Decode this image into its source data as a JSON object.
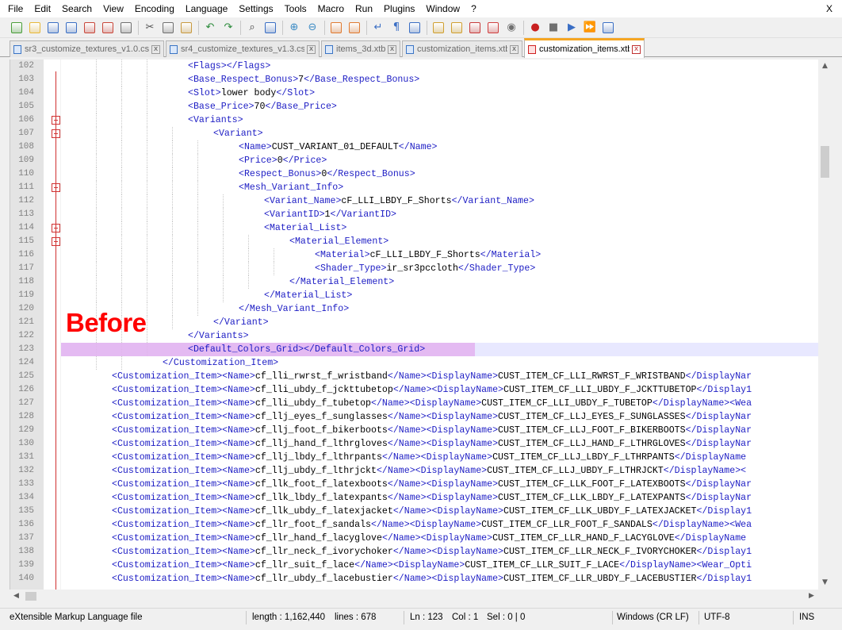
{
  "menu": [
    "File",
    "Edit",
    "Search",
    "View",
    "Encoding",
    "Language",
    "Settings",
    "Tools",
    "Macro",
    "Run",
    "Plugins",
    "Window",
    "?"
  ],
  "window_close": "X",
  "toolbar": [
    {
      "icon": "new-file-icon",
      "color": "#4a9e3a",
      "group_end": false
    },
    {
      "icon": "open-file-icon",
      "color": "#e8b838",
      "group_end": false
    },
    {
      "icon": "save-icon",
      "color": "#3a6ec4",
      "group_end": false
    },
    {
      "icon": "save-all-icon",
      "color": "#3a6ec4",
      "group_end": false
    },
    {
      "icon": "close-icon",
      "color": "#c8463a",
      "group_end": false
    },
    {
      "icon": "close-all-icon",
      "color": "#c8463a",
      "group_end": false
    },
    {
      "icon": "print-icon",
      "color": "#707070",
      "group_end": true
    },
    {
      "icon": "cut-icon",
      "color": "#505050",
      "group_end": false
    },
    {
      "icon": "copy-icon",
      "color": "#707070",
      "group_end": false
    },
    {
      "icon": "paste-icon",
      "color": "#c89a40",
      "group_end": true
    },
    {
      "icon": "undo-icon",
      "color": "#2a8a3a",
      "group_end": false
    },
    {
      "icon": "redo-icon",
      "color": "#2a8a3a",
      "group_end": true
    },
    {
      "icon": "find-icon",
      "color": "#404040",
      "group_end": false
    },
    {
      "icon": "replace-icon",
      "color": "#3a6ec4",
      "group_end": true
    },
    {
      "icon": "zoom-in-icon",
      "color": "#3a8ac4",
      "group_end": false
    },
    {
      "icon": "zoom-out-icon",
      "color": "#3a8ac4",
      "group_end": true
    },
    {
      "icon": "sync-vertical-icon",
      "color": "#e07a30",
      "group_end": false
    },
    {
      "icon": "sync-horizontal-icon",
      "color": "#e07a30",
      "group_end": true
    },
    {
      "icon": "word-wrap-icon",
      "color": "#3a6ec4",
      "group_end": false
    },
    {
      "icon": "show-all-characters-icon",
      "color": "#3a6ec4",
      "group_end": false
    },
    {
      "icon": "indent-guide-icon",
      "color": "#3a6ec4",
      "group_end": true
    },
    {
      "icon": "user-language-icon",
      "color": "#d0a030",
      "group_end": false
    },
    {
      "icon": "document-map-icon",
      "color": "#d0a030",
      "group_end": false
    },
    {
      "icon": "function-list-icon",
      "color": "#c83a3a",
      "group_end": false
    },
    {
      "icon": "folder-workspace-icon",
      "color": "#d04040",
      "group_end": false
    },
    {
      "icon": "monitoring-icon",
      "color": "#707070",
      "group_end": true
    },
    {
      "icon": "record-macro-icon",
      "color": "#c82020",
      "group_end": false
    },
    {
      "icon": "stop-recording-icon",
      "color": "#707070",
      "group_end": false
    },
    {
      "icon": "playback-macro-icon",
      "color": "#3a6ec4",
      "group_end": false
    },
    {
      "icon": "run-macro-multiple-icon",
      "color": "#3a6ec4",
      "group_end": false
    },
    {
      "icon": "save-macro-icon",
      "color": "#3a6ec4",
      "group_end": false
    }
  ],
  "tabs": [
    {
      "label": "sr3_customize_textures_v1.0.csv",
      "active": false,
      "close": "x"
    },
    {
      "label": "sr4_customize_textures_v1.3.csv",
      "active": false,
      "close": "x"
    },
    {
      "label": "items_3d.xtbl",
      "active": false,
      "close": "x"
    },
    {
      "label": "customization_items.xtbl",
      "active": false,
      "close": "x"
    },
    {
      "label": "customization_items.xtbl",
      "active": true,
      "close": "x"
    }
  ],
  "annotation": "Before",
  "lines": [
    {
      "n": "102",
      "indent": 4,
      "parts": [
        [
          "t",
          "<Flags></Flags>"
        ]
      ]
    },
    {
      "n": "103",
      "indent": 4,
      "parts": [
        [
          "t",
          "<Base_Respect_Bonus>"
        ],
        [
          "v",
          "7"
        ],
        [
          "t",
          "</Base_Respect_Bonus>"
        ]
      ]
    },
    {
      "n": "104",
      "indent": 4,
      "parts": [
        [
          "t",
          "<Slot>"
        ],
        [
          "v",
          "lower body"
        ],
        [
          "t",
          "</Slot>"
        ]
      ]
    },
    {
      "n": "105",
      "indent": 4,
      "parts": [
        [
          "t",
          "<Base_Price>"
        ],
        [
          "v",
          "70"
        ],
        [
          "t",
          "</Base_Price>"
        ]
      ]
    },
    {
      "n": "106",
      "indent": 4,
      "fold": true,
      "parts": [
        [
          "t",
          "<Variants>"
        ]
      ]
    },
    {
      "n": "107",
      "indent": 5,
      "fold": true,
      "parts": [
        [
          "t",
          "<Variant>"
        ]
      ]
    },
    {
      "n": "108",
      "indent": 6,
      "parts": [
        [
          "t",
          "<Name>"
        ],
        [
          "v",
          "CUST_VARIANT_01_DEFAULT"
        ],
        [
          "t",
          "</Name>"
        ]
      ]
    },
    {
      "n": "109",
      "indent": 6,
      "parts": [
        [
          "t",
          "<Price>"
        ],
        [
          "v",
          "0"
        ],
        [
          "t",
          "</Price>"
        ]
      ]
    },
    {
      "n": "110",
      "indent": 6,
      "parts": [
        [
          "t",
          "<Respect_Bonus>"
        ],
        [
          "v",
          "0"
        ],
        [
          "t",
          "</Respect_Bonus>"
        ]
      ]
    },
    {
      "n": "111",
      "indent": 6,
      "fold": true,
      "parts": [
        [
          "t",
          "<Mesh_Variant_Info>"
        ]
      ]
    },
    {
      "n": "112",
      "indent": 7,
      "parts": [
        [
          "t",
          "<Variant_Name>"
        ],
        [
          "v",
          "cF_LLI_LBDY_F_Shorts"
        ],
        [
          "t",
          "</Variant_Name>"
        ]
      ]
    },
    {
      "n": "113",
      "indent": 7,
      "parts": [
        [
          "t",
          "<VariantID>"
        ],
        [
          "v",
          "1"
        ],
        [
          "t",
          "</VariantID>"
        ]
      ]
    },
    {
      "n": "114",
      "indent": 7,
      "fold": true,
      "parts": [
        [
          "t",
          "<Material_List>"
        ]
      ]
    },
    {
      "n": "115",
      "indent": 8,
      "fold": true,
      "parts": [
        [
          "t",
          "<Material_Element>"
        ]
      ]
    },
    {
      "n": "116",
      "indent": 9,
      "parts": [
        [
          "t",
          "<Material>"
        ],
        [
          "v",
          "cF_LLI_LBDY_F_Shorts"
        ],
        [
          "t",
          "</Material>"
        ]
      ]
    },
    {
      "n": "117",
      "indent": 9,
      "parts": [
        [
          "t",
          "<Shader_Type>"
        ],
        [
          "v",
          "ir_sr3pccloth"
        ],
        [
          "t",
          "</Shader_Type>"
        ]
      ]
    },
    {
      "n": "118",
      "indent": 8,
      "parts": [
        [
          "t",
          "</Material_Element>"
        ]
      ]
    },
    {
      "n": "119",
      "indent": 7,
      "parts": [
        [
          "t",
          "</Material_List>"
        ]
      ]
    },
    {
      "n": "120",
      "indent": 6,
      "parts": [
        [
          "t",
          "</Mesh_Variant_Info>"
        ]
      ]
    },
    {
      "n": "121",
      "indent": 5,
      "parts": [
        [
          "t",
          "</Variant>"
        ]
      ]
    },
    {
      "n": "122",
      "indent": 4,
      "parts": [
        [
          "t",
          "</Variants>"
        ]
      ]
    },
    {
      "n": "123",
      "indent": 4,
      "current": true,
      "parts": [
        [
          "t",
          "<Default_Colors_Grid></Default_Colors_Grid>"
        ]
      ]
    },
    {
      "n": "124",
      "indent": 3,
      "parts": [
        [
          "t",
          "</Customization_Item>"
        ]
      ]
    },
    {
      "n": "125",
      "indent": 1,
      "parts": [
        [
          "t",
          "<Customization_Item><Name>"
        ],
        [
          "v",
          "cf_lli_rwrst_f_wristband"
        ],
        [
          "t",
          "</Name><DisplayName>"
        ],
        [
          "v",
          "CUST_ITEM_CF_LLI_RWRST_F_WRISTBAND"
        ],
        [
          "t",
          "</DisplayNar"
        ]
      ]
    },
    {
      "n": "126",
      "indent": 1,
      "parts": [
        [
          "t",
          "<Customization_Item><Name>"
        ],
        [
          "v",
          "cf_lli_ubdy_f_jckttubetop"
        ],
        [
          "t",
          "</Name><DisplayName>"
        ],
        [
          "v",
          "CUST_ITEM_CF_LLI_UBDY_F_JCKTTUBETOP"
        ],
        [
          "t",
          "</Display1"
        ]
      ]
    },
    {
      "n": "127",
      "indent": 1,
      "parts": [
        [
          "t",
          "<Customization_Item><Name>"
        ],
        [
          "v",
          "cf_lli_ubdy_f_tubetop"
        ],
        [
          "t",
          "</Name><DisplayName>"
        ],
        [
          "v",
          "CUST_ITEM_CF_LLI_UBDY_F_TUBETOP"
        ],
        [
          "t",
          "</DisplayName><Wea"
        ]
      ]
    },
    {
      "n": "128",
      "indent": 1,
      "parts": [
        [
          "t",
          "<Customization_Item><Name>"
        ],
        [
          "v",
          "cf_llj_eyes_f_sunglasses"
        ],
        [
          "t",
          "</Name><DisplayName>"
        ],
        [
          "v",
          "CUST_ITEM_CF_LLJ_EYES_F_SUNGLASSES"
        ],
        [
          "t",
          "</DisplayNar"
        ]
      ]
    },
    {
      "n": "129",
      "indent": 1,
      "parts": [
        [
          "t",
          "<Customization_Item><Name>"
        ],
        [
          "v",
          "cf_llj_foot_f_bikerboots"
        ],
        [
          "t",
          "</Name><DisplayName>"
        ],
        [
          "v",
          "CUST_ITEM_CF_LLJ_FOOT_F_BIKERBOOTS"
        ],
        [
          "t",
          "</DisplayNar"
        ]
      ]
    },
    {
      "n": "130",
      "indent": 1,
      "parts": [
        [
          "t",
          "<Customization_Item><Name>"
        ],
        [
          "v",
          "cf_llj_hand_f_lthrgloves"
        ],
        [
          "t",
          "</Name><DisplayName>"
        ],
        [
          "v",
          "CUST_ITEM_CF_LLJ_HAND_F_LTHRGLOVES"
        ],
        [
          "t",
          "</DisplayNar"
        ]
      ]
    },
    {
      "n": "131",
      "indent": 1,
      "parts": [
        [
          "t",
          "<Customization_Item><Name>"
        ],
        [
          "v",
          "cf_llj_lbdy_f_lthrpants"
        ],
        [
          "t",
          "</Name><DisplayName>"
        ],
        [
          "v",
          "CUST_ITEM_CF_LLJ_LBDY_F_LTHRPANTS"
        ],
        [
          "t",
          "</DisplayName"
        ]
      ]
    },
    {
      "n": "132",
      "indent": 1,
      "parts": [
        [
          "t",
          "<Customization_Item><Name>"
        ],
        [
          "v",
          "cf_llj_ubdy_f_lthrjckt"
        ],
        [
          "t",
          "</Name><DisplayName>"
        ],
        [
          "v",
          "CUST_ITEM_CF_LLJ_UBDY_F_LTHRJCKT"
        ],
        [
          "t",
          "</DisplayName><"
        ]
      ]
    },
    {
      "n": "133",
      "indent": 1,
      "parts": [
        [
          "t",
          "<Customization_Item><Name>"
        ],
        [
          "v",
          "cf_llk_foot_f_latexboots"
        ],
        [
          "t",
          "</Name><DisplayName>"
        ],
        [
          "v",
          "CUST_ITEM_CF_LLK_FOOT_F_LATEXBOOTS"
        ],
        [
          "t",
          "</DisplayNar"
        ]
      ]
    },
    {
      "n": "134",
      "indent": 1,
      "parts": [
        [
          "t",
          "<Customization_Item><Name>"
        ],
        [
          "v",
          "cf_llk_lbdy_f_latexpants"
        ],
        [
          "t",
          "</Name><DisplayName>"
        ],
        [
          "v",
          "CUST_ITEM_CF_LLK_LBDY_F_LATEXPANTS"
        ],
        [
          "t",
          "</DisplayNar"
        ]
      ]
    },
    {
      "n": "135",
      "indent": 1,
      "parts": [
        [
          "t",
          "<Customization_Item><Name>"
        ],
        [
          "v",
          "cf_llk_ubdy_f_latexjacket"
        ],
        [
          "t",
          "</Name><DisplayName>"
        ],
        [
          "v",
          "CUST_ITEM_CF_LLK_UBDY_F_LATEXJACKET"
        ],
        [
          "t",
          "</Display1"
        ]
      ]
    },
    {
      "n": "136",
      "indent": 1,
      "parts": [
        [
          "t",
          "<Customization_Item><Name>"
        ],
        [
          "v",
          "cf_llr_foot_f_sandals"
        ],
        [
          "t",
          "</Name><DisplayName>"
        ],
        [
          "v",
          "CUST_ITEM_CF_LLR_FOOT_F_SANDALS"
        ],
        [
          "t",
          "</DisplayName><Wea"
        ]
      ]
    },
    {
      "n": "137",
      "indent": 1,
      "parts": [
        [
          "t",
          "<Customization_Item><Name>"
        ],
        [
          "v",
          "cf_llr_hand_f_lacyglove"
        ],
        [
          "t",
          "</Name><DisplayName>"
        ],
        [
          "v",
          "CUST_ITEM_CF_LLR_HAND_F_LACYGLOVE"
        ],
        [
          "t",
          "</DisplayName"
        ]
      ]
    },
    {
      "n": "138",
      "indent": 1,
      "parts": [
        [
          "t",
          "<Customization_Item><Name>"
        ],
        [
          "v",
          "cf_llr_neck_f_ivorychoker"
        ],
        [
          "t",
          "</Name><DisplayName>"
        ],
        [
          "v",
          "CUST_ITEM_CF_LLR_NECK_F_IVORYCHOKER"
        ],
        [
          "t",
          "</Display1"
        ]
      ]
    },
    {
      "n": "139",
      "indent": 1,
      "parts": [
        [
          "t",
          "<Customization_Item><Name>"
        ],
        [
          "v",
          "cf_llr_suit_f_lace"
        ],
        [
          "t",
          "</Name><DisplayName>"
        ],
        [
          "v",
          "CUST_ITEM_CF_LLR_SUIT_F_LACE"
        ],
        [
          "t",
          "</DisplayName><Wear_Opti"
        ]
      ]
    },
    {
      "n": "140",
      "indent": 1,
      "parts": [
        [
          "t",
          "<Customization_Item><Name>"
        ],
        [
          "v",
          "cf_llr_ubdy_f_lacebustier"
        ],
        [
          "t",
          "</Name><DisplayName>"
        ],
        [
          "v",
          "CUST_ITEM_CF_LLR_UBDY_F_LACEBUSTIER"
        ],
        [
          "t",
          "</Display1"
        ]
      ]
    }
  ],
  "status": {
    "file_type": "eXtensible Markup Language file",
    "length": "length : 1,162,440",
    "lines": "lines : 678",
    "ln": "Ln : 123",
    "col": "Col : 1",
    "sel": "Sel : 0 | 0",
    "eol": "Windows (CR LF)",
    "encoding": "UTF-8",
    "mode": "INS"
  },
  "colors": {
    "tag": "#1c1cc4",
    "current_line": "#e8e8ff",
    "selection": "#e3b2f0",
    "annotation": "#ff0000",
    "active_tab_accent": "#f5a623",
    "fold_marker": "#d03030"
  }
}
